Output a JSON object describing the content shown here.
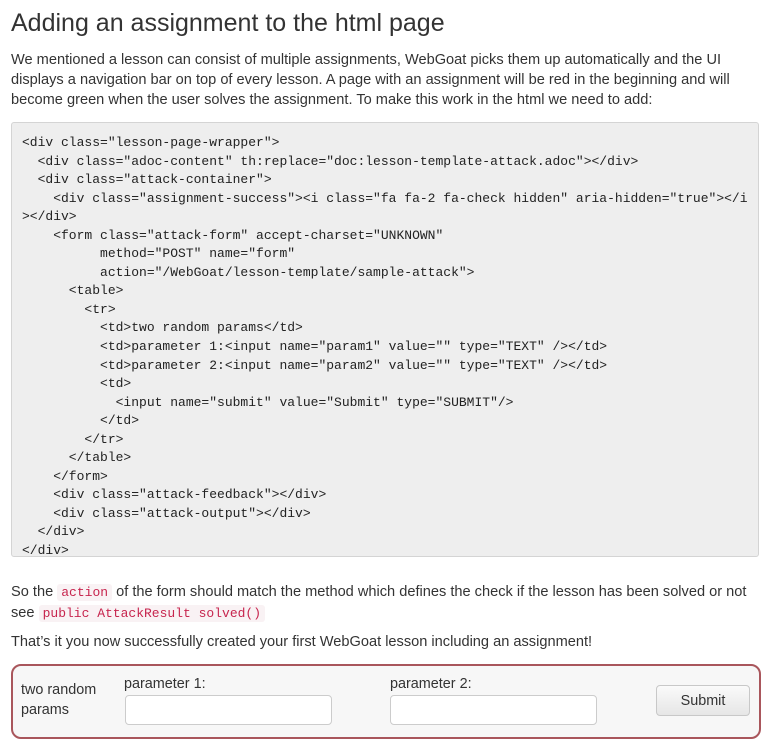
{
  "heading": "Adding an assignment to the html page",
  "intro": "We mentioned a lesson can consist of multiple assignments, WebGoat picks them up automatically and the UI displays a navigation bar on top of every lesson. A page with an assignment will be red in the beginning and will become green when the user solves the assignment. To make this work in the html we need to add:",
  "code_block": "<div class=\"lesson-page-wrapper\">\n  <div class=\"adoc-content\" th:replace=\"doc:lesson-template-attack.adoc\"></div>\n  <div class=\"attack-container\">\n    <div class=\"assignment-success\"><i class=\"fa fa-2 fa-check hidden\" aria-hidden=\"true\"></i\n></div>\n    <form class=\"attack-form\" accept-charset=\"UNKNOWN\"\n          method=\"POST\" name=\"form\"\n          action=\"/WebGoat/lesson-template/sample-attack\">\n      <table>\n        <tr>\n          <td>two random params</td>\n          <td>parameter 1:<input name=\"param1\" value=\"\" type=\"TEXT\" /></td>\n          <td>parameter 2:<input name=\"param2\" value=\"\" type=\"TEXT\" /></td>\n          <td>\n            <input name=\"submit\" value=\"Submit\" type=\"SUBMIT\"/>\n          </td>\n        </tr>\n      </table>\n    </form>\n    <div class=\"attack-feedback\"></div>\n    <div class=\"attack-output\"></div>\n  </div>\n</div>",
  "para2": {
    "before": "So the ",
    "code1": "action",
    "middle": " of the form should match the method which defines the check if the lesson has been solved or not see ",
    "code2": "public AttackResult solved()"
  },
  "para3": "That’s it you now successfully created your first WebGoat lesson including an assignment!",
  "form": {
    "label": "two random params",
    "param1_label": "parameter 1:",
    "param1_value": "",
    "param2_label": "parameter 2:",
    "param2_value": "",
    "submit_label": "Submit"
  },
  "colors": {
    "form_border": "#a9565c",
    "inline_code": "#c7254e",
    "code_bg": "#eeeeee"
  }
}
